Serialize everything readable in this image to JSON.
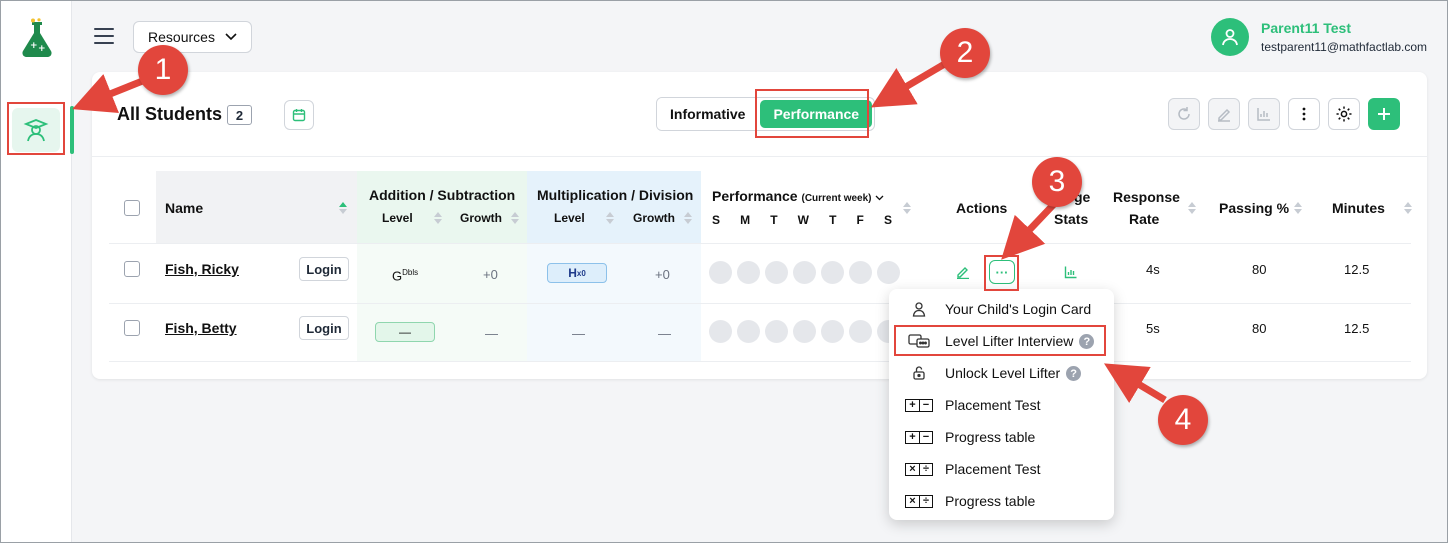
{
  "topbar": {
    "resources_label": "Resources",
    "user_name": "Parent11 Test",
    "user_email": "testparent11@mathfactlab.com"
  },
  "card": {
    "title": "All Students",
    "count": "2",
    "toggle": {
      "informative": "Informative",
      "performance": "Performance",
      "active": "Performance"
    }
  },
  "table": {
    "headers": {
      "name": "Name",
      "addition": "Addition / Subtraction",
      "multiplication": "Multiplication / Division",
      "level": "Level",
      "growth": "Growth",
      "performance": "Performance",
      "performance_sub": "(Current week)",
      "days": [
        "S",
        "M",
        "T",
        "W",
        "T",
        "F",
        "S"
      ],
      "actions": "Actions",
      "usage_stats_1": "ge",
      "usage_stats_2": "Stats",
      "response_rate_1": "Response",
      "response_rate_2": "Rate",
      "passing": "Passing %",
      "minutes": "Minutes"
    },
    "login_label": "Login",
    "rows": [
      {
        "name": "Fish, Ricky",
        "add_level": "G",
        "add_level_sup": "Dbls",
        "add_growth": "+0",
        "mul_level": "H",
        "mul_level_sup": "x0",
        "mul_growth": "+0",
        "response_rate": "4s",
        "passing": "80",
        "minutes": "12.5"
      },
      {
        "name": "Fish, Betty",
        "add_level": "—",
        "add_growth": "—",
        "mul_level": "—",
        "mul_growth": "—",
        "response_rate": "5s",
        "passing": "80",
        "minutes": "12.5"
      }
    ],
    "more_label": "···"
  },
  "menu": {
    "items": [
      {
        "label": "Your Child's Login Card",
        "icon": "person-icon",
        "help": false
      },
      {
        "label": "Level Lifter Interview",
        "icon": "interview-icon",
        "help": true
      },
      {
        "label": "Unlock Level Lifter",
        "icon": "unlock-icon",
        "help": true
      },
      {
        "label": "Placement Test",
        "icon": "plus-minus-icon",
        "help": false
      },
      {
        "label": "Progress table",
        "icon": "plus-minus-icon",
        "help": false
      },
      {
        "label": "Placement Test",
        "icon": "times-divide-icon",
        "help": false
      },
      {
        "label": "Progress table",
        "icon": "times-divide-icon",
        "help": false
      }
    ],
    "help_glyph": "?"
  },
  "annotations": {
    "steps": [
      "1",
      "2",
      "3",
      "4"
    ],
    "color": "#e2463c"
  },
  "colors": {
    "brand": "#2dbf7a",
    "addition_bg": "#eaf7ef",
    "multiplication_bg": "#e5f2fb"
  }
}
